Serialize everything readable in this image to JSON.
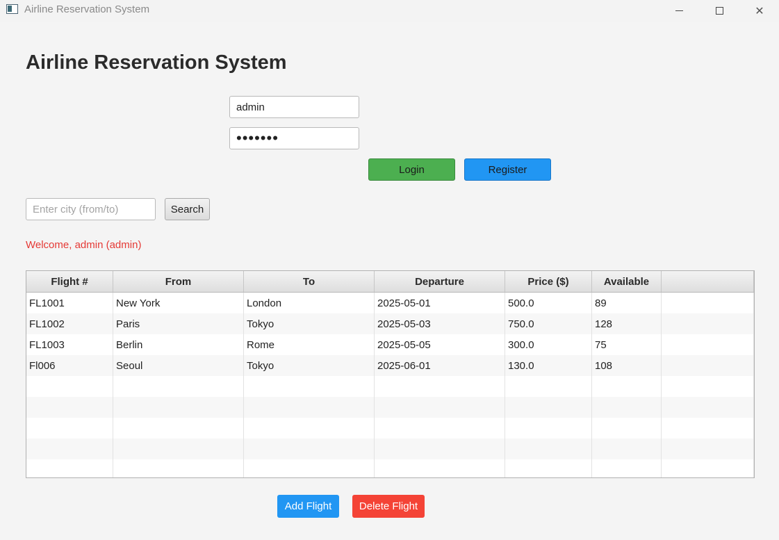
{
  "window": {
    "title": "Airline Reservation System"
  },
  "heading": "Airline Reservation System",
  "login": {
    "username": "admin",
    "password_masked": "•••••••",
    "login_label": "Login",
    "register_label": "Register"
  },
  "search": {
    "placeholder": "Enter city (from/to)",
    "button_label": "Search"
  },
  "welcome_message": "Welcome, admin (admin)",
  "table": {
    "headers": [
      "Flight #",
      "From",
      "To",
      "Departure",
      "Price ($)",
      "Available"
    ],
    "rows": [
      [
        "FL1001",
        "New York",
        "London",
        "2025-05-01",
        "500.0",
        "89"
      ],
      [
        "FL1002",
        "Paris",
        "Tokyo",
        "2025-05-03",
        "750.0",
        "128"
      ],
      [
        "FL1003",
        "Berlin",
        "Rome",
        "2025-05-05",
        "300.0",
        "75"
      ],
      [
        "Fl006",
        "Seoul",
        "Tokyo",
        "2025-06-01",
        "130.0",
        "108"
      ]
    ],
    "empty_rows": 5
  },
  "actions": {
    "add_label": "Add Flight",
    "delete_label": "Delete Flight"
  },
  "colors": {
    "login_bg": "#4caf50",
    "register_bg": "#2196f3",
    "add_bg": "#2196f3",
    "delete_bg": "#f44336",
    "welcome_text": "#e53935"
  }
}
